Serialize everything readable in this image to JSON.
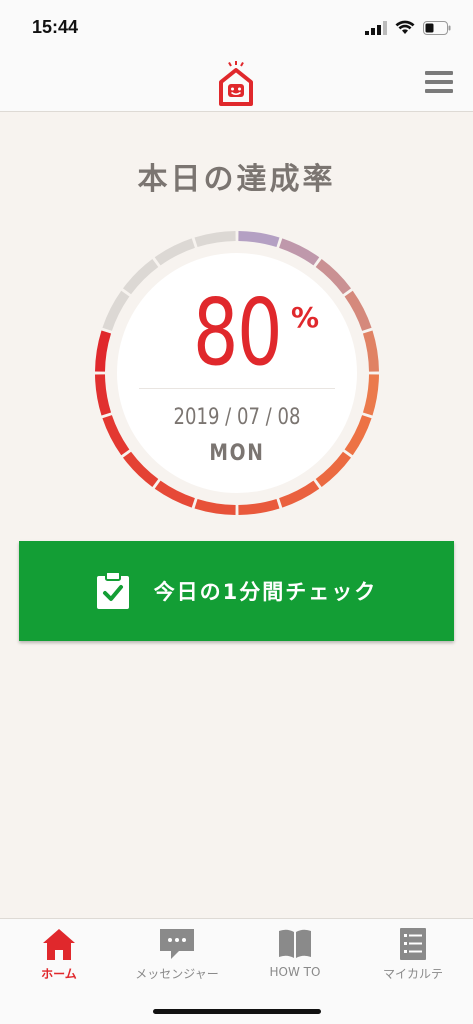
{
  "status_bar": {
    "time": "15:44"
  },
  "header": {
    "logo": "house-face-logo",
    "menu": "hamburger-menu-icon"
  },
  "main": {
    "title": "本日の達成率",
    "percent": "80",
    "percent_sign": "%",
    "date": "2019 / 07 / 08",
    "day": "MON"
  },
  "progress": {
    "value": 80,
    "segments": 20
  },
  "check_button": {
    "label": "今日の1分間チェック",
    "icon": "clipboard-check-icon"
  },
  "tabs": [
    {
      "label": "ホーム",
      "icon": "home-icon",
      "active": true
    },
    {
      "label": "メッセンジャー",
      "icon": "chat-icon",
      "active": false
    },
    {
      "label": "HOW TO",
      "icon": "book-icon",
      "active": false
    },
    {
      "label": "マイカルテ",
      "icon": "list-icon",
      "active": false
    }
  ],
  "colors": {
    "accent": "#e0282c",
    "button_green": "#139e35",
    "text_gray": "#7b7571",
    "background": "#f7f3ef",
    "gauge_inactive": "#dcd8d4"
  }
}
